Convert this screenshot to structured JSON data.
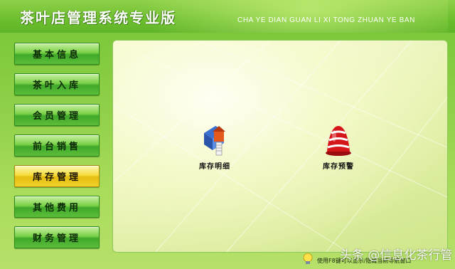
{
  "header": {
    "title": "茶叶店管理系统专业版",
    "subtitle": "CHA YE DIAN GUAN LI XI TONG ZHUAN YE BAN"
  },
  "sidebar": {
    "items": [
      {
        "label": "基本信息"
      },
      {
        "label": "茶叶入库"
      },
      {
        "label": "会员管理"
      },
      {
        "label": "前台销售"
      },
      {
        "label": "库存管理"
      },
      {
        "label": "其他费用"
      },
      {
        "label": "财务管理"
      }
    ],
    "active_index": 4
  },
  "main": {
    "modules": [
      {
        "label": "库存明细",
        "icon": "inventory-detail-icon"
      },
      {
        "label": "库存预警",
        "icon": "alarm-bell-icon"
      }
    ]
  },
  "status": {
    "text": "使用F8键可以显示/隐藏当前导航窗口"
  },
  "watermark": {
    "text": "头条 @信息化茶行管"
  },
  "colors": {
    "accent_green": "#6cbf2e",
    "active_yellow": "#f5dc3c",
    "alarm_red": "#d4161b"
  }
}
